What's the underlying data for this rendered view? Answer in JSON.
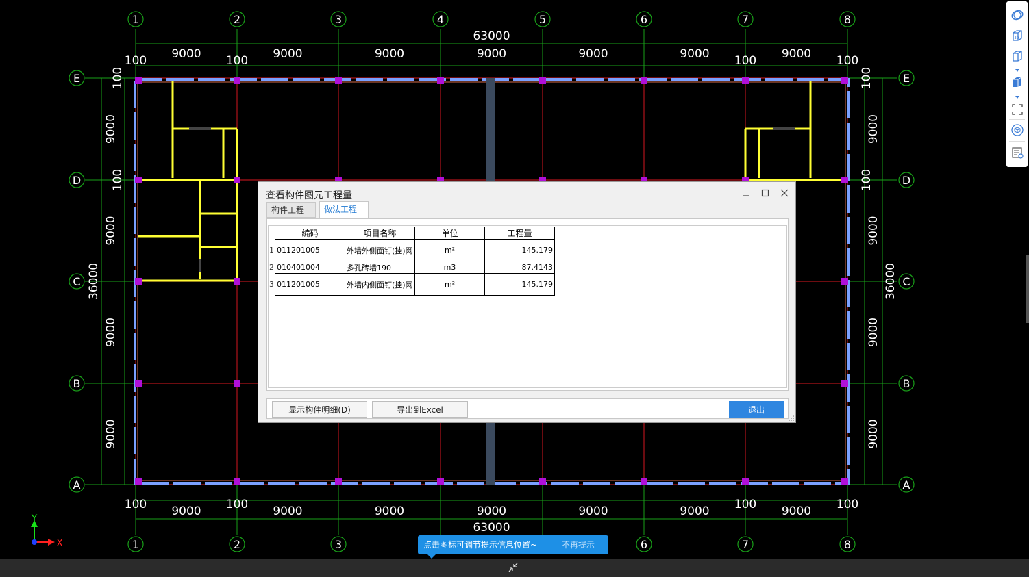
{
  "cad": {
    "column_axes": [
      "1",
      "2",
      "3",
      "4",
      "5",
      "6",
      "7",
      "8"
    ],
    "row_axes": [
      "E",
      "D",
      "C",
      "B",
      "A"
    ],
    "total_width": "63000",
    "total_height": "36000",
    "bay_width": "9000",
    "bay_height": "9000",
    "offset": "100",
    "axis_x_label": "X",
    "axis_y_label": "Y",
    "colors": {
      "grid": "#b0131a",
      "dimension": "#19a019",
      "wall_yellow": "#ffff33",
      "column_magenta": "#b010d8",
      "outer_wall": "#7aa0ff"
    }
  },
  "dialog": {
    "title": "查看构件图元工程量",
    "tabs": [
      {
        "label": "构件工程量",
        "active": false
      },
      {
        "label": "做法工程量",
        "active": true
      }
    ],
    "table": {
      "headers": [
        "编码",
        "项目名称",
        "单位",
        "工程量"
      ],
      "rows": [
        {
          "no": "1",
          "code": "011201005",
          "name": "外墙外侧面钉(挂)网",
          "unit": "m²",
          "qty": "145.179"
        },
        {
          "no": "2",
          "code": "010401004",
          "name": "多孔砖墙190",
          "unit": "m3",
          "qty": "87.4143"
        },
        {
          "no": "3",
          "code": "011201005",
          "name": "外墙内侧面钉(挂)网",
          "unit": "m²",
          "qty": "145.179"
        }
      ]
    },
    "buttons": {
      "show_detail": "显示构件明细(D)",
      "export_excel": "导出到Excel",
      "exit": "退出"
    }
  },
  "tip": {
    "text": "点击图标可调节提示信息位置~",
    "dismiss": "不再提示"
  },
  "toolbar": {
    "icons": [
      "orbit-icon",
      "3d-view-icon",
      "box-view-icon",
      "solid-box-icon",
      "fullscreen-icon",
      "cube-reset-icon",
      "list-settings-icon"
    ]
  }
}
